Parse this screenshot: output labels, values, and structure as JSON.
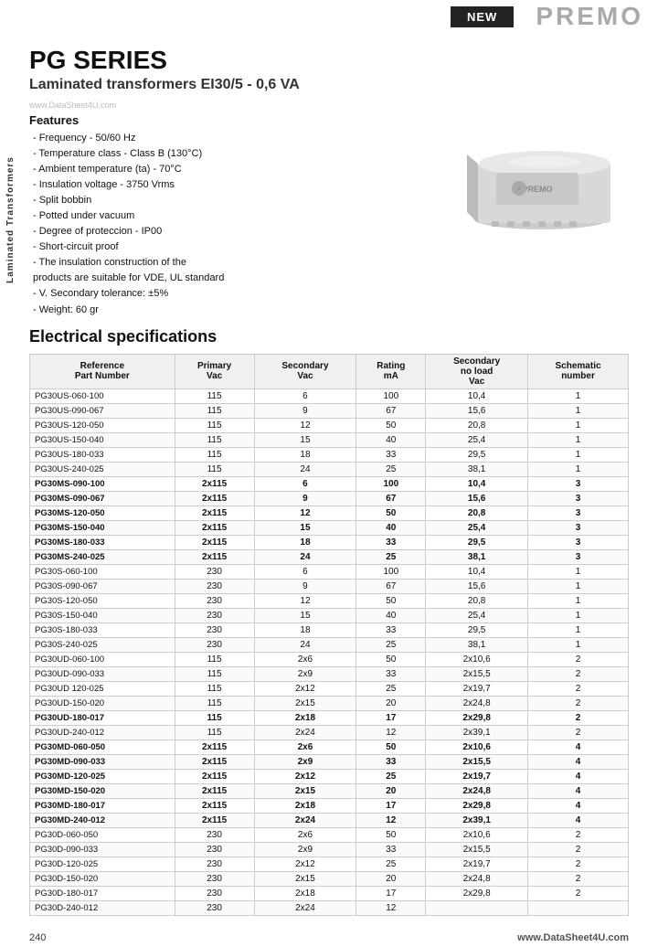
{
  "header": {
    "new_badge": "NEW",
    "brand": "PREMO"
  },
  "series": {
    "title": "PG SERIES",
    "subtitle": "Laminated transformers EI30/5 - 0,6 VA",
    "watermark": "www.DataSheet4U.com"
  },
  "side_label": "Laminated Transformers",
  "features": {
    "title": "Features",
    "items": [
      "- Frequency - 50/60 Hz",
      "- Temperature class - Class B (130°C)",
      "- Ambient temperature (ta) - 70°C",
      "- Insulation voltage - 3750 Vrms",
      "- Split bobbin",
      "- Potted under vacuum",
      "- Degree of proteccion - IP00",
      "- Short-circuit proof",
      "- The insulation construction of the",
      "  products are suitable for VDE, UL standard",
      "- V. Secondary tolerance: ±5%",
      "- Weight: 60 gr"
    ]
  },
  "electrical": {
    "title": "Electrical specifications"
  },
  "table": {
    "headers": [
      "Reference\nPart Number",
      "Primary\nVac",
      "Secondary\nVac",
      "Rating\nmA",
      "Secondary\nno load\nVac",
      "Schematic\nnumber"
    ],
    "rows": [
      [
        "PG30US-060-100",
        "115",
        "6",
        "100",
        "10,4",
        "1"
      ],
      [
        "PG30US-090-067",
        "115",
        "9",
        "67",
        "15,6",
        "1"
      ],
      [
        "PG30US-120-050",
        "115",
        "12",
        "50",
        "20,8",
        "1"
      ],
      [
        "PG30US-150-040",
        "115",
        "15",
        "40",
        "25,4",
        "1"
      ],
      [
        "PG30US-180-033",
        "115",
        "18",
        "33",
        "29,5",
        "1"
      ],
      [
        "PG30US-240-025",
        "115",
        "24",
        "25",
        "38,1",
        "1"
      ],
      [
        "PG30MS-090-100",
        "2x115",
        "6",
        "100",
        "10,4",
        "3"
      ],
      [
        "PG30MS-090-067",
        "2x115",
        "9",
        "67",
        "15,6",
        "3"
      ],
      [
        "PG30MS-120-050",
        "2x115",
        "12",
        "50",
        "20,8",
        "3"
      ],
      [
        "PG30MS-150-040",
        "2x115",
        "15",
        "40",
        "25,4",
        "3"
      ],
      [
        "PG30MS-180-033",
        "2x115",
        "18",
        "33",
        "29,5",
        "3"
      ],
      [
        "PG30MS-240-025",
        "2x115",
        "24",
        "25",
        "38,1",
        "3"
      ],
      [
        "PG30S-060-100",
        "230",
        "6",
        "100",
        "10,4",
        "1"
      ],
      [
        "PG30S-090-067",
        "230",
        "9",
        "67",
        "15,6",
        "1"
      ],
      [
        "PG30S-120-050",
        "230",
        "12",
        "50",
        "20,8",
        "1"
      ],
      [
        "PG30S-150-040",
        "230",
        "15",
        "40",
        "25,4",
        "1"
      ],
      [
        "PG30S-180-033",
        "230",
        "18",
        "33",
        "29,5",
        "1"
      ],
      [
        "PG30S-240-025",
        "230",
        "24",
        "25",
        "38,1",
        "1"
      ],
      [
        "PG30UD-060-100",
        "115",
        "2x6",
        "50",
        "2x10,6",
        "2"
      ],
      [
        "PG30UD-090-033",
        "115",
        "2x9",
        "33",
        "2x15,5",
        "2"
      ],
      [
        "PG30UD 120-025",
        "115",
        "2x12",
        "25",
        "2x19,7",
        "2"
      ],
      [
        "PG30UD-150-020",
        "115",
        "2x15",
        "20",
        "2x24,8",
        "2"
      ],
      [
        "PG30UD-180-017",
        "115",
        "2x18",
        "17",
        "2x29,8",
        "2"
      ],
      [
        "PG30UD-240-012",
        "115",
        "2x24",
        "12",
        "2x39,1",
        "2"
      ],
      [
        "PG30MD-060-050",
        "2x115",
        "2x6",
        "50",
        "2x10,6",
        "4"
      ],
      [
        "PG30MD-090-033",
        "2x115",
        "2x9",
        "33",
        "2x15,5",
        "4"
      ],
      [
        "PG30MD-120-025",
        "2x115",
        "2x12",
        "25",
        "2x19,7",
        "4"
      ],
      [
        "PG30MD-150-020",
        "2x115",
        "2x15",
        "20",
        "2x24,8",
        "4"
      ],
      [
        "PG30MD-180-017",
        "2x115",
        "2x18",
        "17",
        "2x29,8",
        "4"
      ],
      [
        "PG30MD-240-012",
        "2x115",
        "2x24",
        "12",
        "2x39,1",
        "4"
      ],
      [
        "PG30D-060-050",
        "230",
        "2x6",
        "50",
        "2x10,6",
        "2"
      ],
      [
        "PG30D-090-033",
        "230",
        "2x9",
        "33",
        "2x15,5",
        "2"
      ],
      [
        "PG30D-120-025",
        "230",
        "2x12",
        "25",
        "2x19,7",
        "2"
      ],
      [
        "PG30D-150-020",
        "230",
        "2x15",
        "20",
        "2x24,8",
        "2"
      ],
      [
        "PG30D-180-017",
        "230",
        "2x18",
        "17",
        "2x29,8",
        "2"
      ],
      [
        "PG30D-240-012",
        "230",
        "2x24",
        "12",
        "",
        ""
      ]
    ]
  },
  "footer": {
    "page_number": "240",
    "url": "www.DataSheet4U.com"
  }
}
